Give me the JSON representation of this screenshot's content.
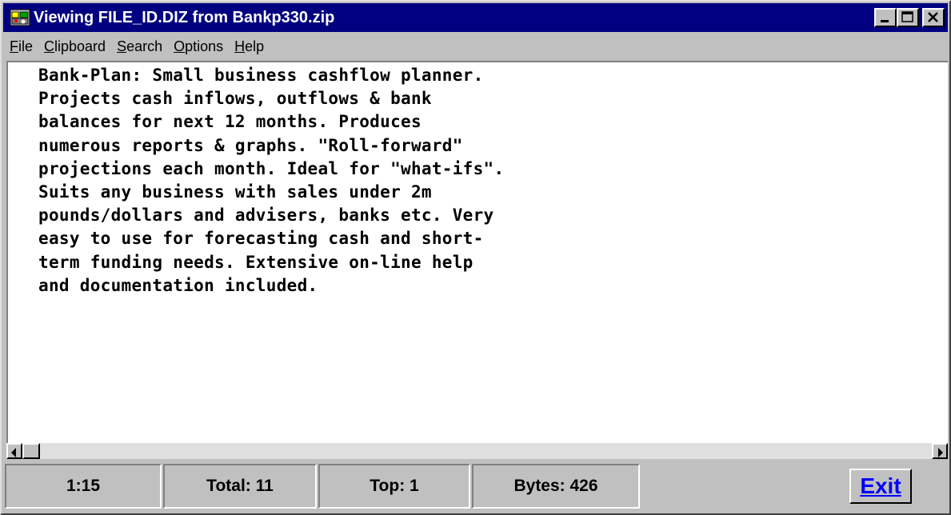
{
  "window": {
    "title": "Viewing FILE_ID.DIZ from Bankp330.zip",
    "app_icon": "viewer-app-icon",
    "controls": [
      "minimize-icon",
      "maximize-icon",
      "close-icon"
    ]
  },
  "menu": {
    "items": [
      {
        "accel": "F",
        "rest": "ile"
      },
      {
        "accel": "C",
        "rest": "lipboard"
      },
      {
        "accel": "S",
        "rest": "earch"
      },
      {
        "accel": "O",
        "rest": "ptions"
      },
      {
        "accel": "H",
        "rest": "elp"
      }
    ]
  },
  "document": {
    "lines": [
      "Bank-Plan: Small business cashflow planner.",
      "Projects cash inflows, outflows & bank",
      "balances for next 12 months. Produces",
      "numerous reports & graphs. \"Roll-forward\"",
      "projections each month. Ideal for \"what-ifs\".",
      "Suits any business with sales under 2m",
      "pounds/dollars and advisers, banks etc. Very",
      "easy to use for forecasting cash and short-",
      "term funding needs. Extensive on-line help",
      "and documentation included."
    ]
  },
  "status": {
    "position": "1:15",
    "total": "Total: 11",
    "top": "Top: 1",
    "bytes": "Bytes: 426",
    "exit_label": "Exit"
  },
  "colors": {
    "titlebar": "#000080",
    "face": "#c0c0c0",
    "exit_text": "#0000ff"
  }
}
